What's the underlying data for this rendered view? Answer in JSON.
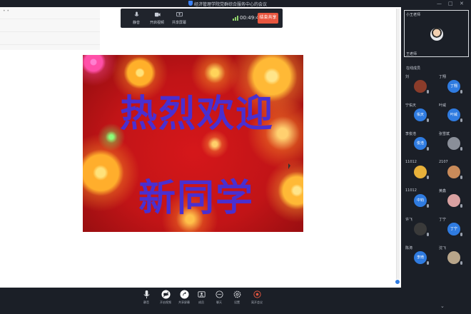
{
  "window": {
    "title": "经济管理学院党群综合服务中心的会议",
    "controls": [
      "—",
      "□",
      "✕"
    ]
  },
  "share_area": {
    "corner_mark": "• •"
  },
  "slide": {
    "line1": "热烈欢迎",
    "line2": "新同学",
    "text_color": "#4a2fd0",
    "background_color": "#c81518"
  },
  "top_toolbar": {
    "items": [
      {
        "label": "静音",
        "icon": "microphone-icon"
      },
      {
        "label": "开启视频",
        "icon": "video-camera-icon"
      },
      {
        "label": "共享屏幕",
        "icon": "share-screen-icon"
      }
    ],
    "timer": "00:49:48",
    "stop_share_label": "结束共享",
    "stop_share_color": "#e8563f"
  },
  "self_view": {
    "name": "小王老师",
    "label": "王老师"
  },
  "participants_header": "在线成员",
  "participants": [
    {
      "name": "刘",
      "avatar_text": "",
      "avatar_color": "#8b3c2a"
    },
    {
      "name": "丁翔",
      "avatar_text": "丁翔",
      "avatar_color": "#2f7be0"
    },
    {
      "name": "宁佑天",
      "avatar_text": "佑天",
      "avatar_color": "#2f7be0"
    },
    {
      "name": "叶威",
      "avatar_text": "叶威",
      "avatar_color": "#2f7be0"
    },
    {
      "name": "李俊浩",
      "avatar_text": "俊浩",
      "avatar_color": "#2f7be0"
    },
    {
      "name": "张雪斌",
      "avatar_text": "",
      "avatar_color": "#8a8f99"
    },
    {
      "name": "11012",
      "avatar_text": "",
      "avatar_color": "#e8b13a"
    },
    {
      "name": "2107",
      "avatar_text": "",
      "avatar_color": "#c98b5a"
    },
    {
      "name": "11012",
      "avatar_text": "中钧",
      "avatar_color": "#2f7be0"
    },
    {
      "name": "黄鑫",
      "avatar_text": "",
      "avatar_color": "#d9a1a1"
    },
    {
      "name": "许飞",
      "avatar_text": "",
      "avatar_color": "#3a3a3a"
    },
    {
      "name": "丁宁",
      "avatar_text": "丁宁",
      "avatar_color": "#2f7be0"
    },
    {
      "name": "陈涛",
      "avatar_text": "李琦",
      "avatar_color": "#2f7be0"
    },
    {
      "name": "沈飞",
      "avatar_text": "",
      "avatar_color": "#b8a58a"
    }
  ],
  "bottom_toolbar": {
    "items": [
      {
        "label": "静音",
        "icon": "microphone-icon"
      },
      {
        "label": "开启视频",
        "icon": "video-camera-icon"
      },
      {
        "label": "共享屏幕",
        "icon": "share-screen-icon"
      },
      {
        "label": "成员",
        "icon": "members-icon"
      },
      {
        "label": "聊天",
        "icon": "chat-icon"
      },
      {
        "label": "设置",
        "icon": "gear-icon"
      },
      {
        "label": "离开会议",
        "icon": "leave-icon"
      }
    ]
  }
}
